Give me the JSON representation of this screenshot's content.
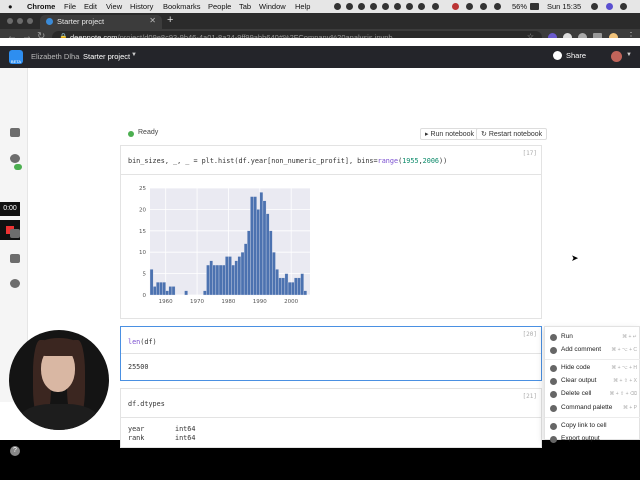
{
  "macos": {
    "app_name": "Chrome",
    "menu": [
      "File",
      "Edit",
      "View",
      "History",
      "Bookmarks",
      "People",
      "Tab",
      "Window",
      "Help"
    ],
    "battery": "56%",
    "clock": "Sun 15:35"
  },
  "browser": {
    "tab_title": "Starter project",
    "url_host": "deepnote.com",
    "url_path": "/project/d09e8c93-9b46-4a01-8a24-9ff99abb640#%2FCompany%20analysis.ipynb"
  },
  "app": {
    "user_name": "Elizabeth Dlha",
    "project_title": "Starter project",
    "share_label": "Share",
    "logo_badge": "BETA"
  },
  "sidebar": {
    "timer": "0:00"
  },
  "notebook": {
    "status": "Ready",
    "run_notebook": "Run notebook",
    "restart_notebook": "Restart notebook",
    "cells": [
      {
        "num": "[17]",
        "code_parts": [
          "bin_sizes, _, _ = plt.hist(df.year[non_numeric_profit], bins=",
          "range",
          "(",
          "1955",
          ",",
          "2006",
          "))"
        ]
      },
      {
        "num": "[20]",
        "code_fn": "len",
        "code_rest": "(df)",
        "output": "25500"
      },
      {
        "num": "[21]",
        "code": "df.dtypes",
        "output_rows": [
          {
            "name": "year",
            "dtype": "int64"
          },
          {
            "name": "rank",
            "dtype": "int64"
          }
        ]
      }
    ]
  },
  "chart_data": {
    "type": "bar",
    "title": "",
    "xlabel": "",
    "ylabel": "",
    "xlim": [
      1955,
      2006
    ],
    "ylim": [
      0,
      25
    ],
    "xticks": [
      "1960",
      "1970",
      "1980",
      "1990",
      "2000"
    ],
    "yticks": [
      "0",
      "5",
      "10",
      "15",
      "20",
      "25"
    ],
    "color": "#4c72b0",
    "grid": true,
    "x": [
      1955,
      1956,
      1957,
      1958,
      1959,
      1960,
      1961,
      1962,
      1963,
      1964,
      1965,
      1966,
      1967,
      1968,
      1969,
      1970,
      1971,
      1972,
      1973,
      1974,
      1975,
      1976,
      1977,
      1978,
      1979,
      1980,
      1981,
      1982,
      1983,
      1984,
      1985,
      1986,
      1987,
      1988,
      1989,
      1990,
      1991,
      1992,
      1993,
      1994,
      1995,
      1996,
      1997,
      1998,
      1999,
      2000,
      2001,
      2002,
      2003,
      2004,
      2005
    ],
    "values": [
      6,
      2,
      3,
      3,
      3,
      1,
      2,
      2,
      0,
      0,
      0,
      1,
      0,
      0,
      0,
      0,
      0,
      1,
      7,
      8,
      7,
      7,
      7,
      7,
      9,
      9,
      7,
      8,
      9,
      10,
      12,
      15,
      23,
      23,
      20,
      24,
      22,
      19,
      15,
      10,
      6,
      4,
      4,
      5,
      3,
      3,
      4,
      4,
      5,
      1,
      0
    ]
  },
  "context_menu": {
    "items": [
      {
        "label": "Run",
        "key": "⌘ + ↵"
      },
      {
        "label": "Add comment",
        "key": "⌘ + ⌥ + C"
      },
      {
        "label": "Hide code",
        "key": "⌘ + ⌥ + H"
      },
      {
        "label": "Clear output",
        "key": "⌘ + ⇧ + X"
      },
      {
        "label": "Delete cell",
        "key": "⌘ + ⇧ + ⌫"
      },
      {
        "label": "Command palette",
        "key": "⌘ + P"
      },
      {
        "label": "Copy link to cell",
        "key": ""
      },
      {
        "label": "Export output",
        "key": ""
      }
    ]
  }
}
